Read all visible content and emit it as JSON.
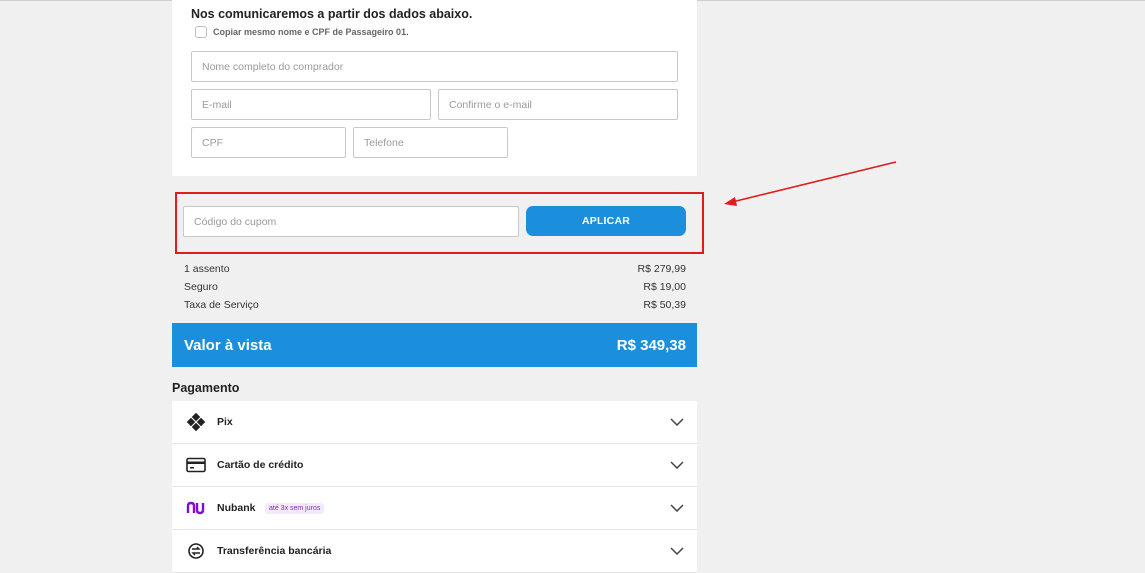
{
  "buyer": {
    "title": "Nos comunicaremos a partir dos dados abaixo.",
    "copy_label": "Copiar mesmo nome e CPF de Passageiro 01.",
    "fields": {
      "full_name_placeholder": "Nome completo do comprador",
      "email_placeholder": "E-mail",
      "email_confirm_placeholder": "Confirme o e-mail",
      "cpf_placeholder": "CPF",
      "phone_placeholder": "Telefone"
    }
  },
  "coupon": {
    "placeholder": "Código do cupom",
    "apply_label": "APLICAR",
    "highlight_color": "#e21b1b"
  },
  "summary": {
    "rows": [
      {
        "label": "1 assento",
        "value": "R$ 279,99"
      },
      {
        "label": "Seguro",
        "value": "R$ 19,00"
      },
      {
        "label": "Taxa de Serviço",
        "value": "R$ 50,39"
      }
    ],
    "total_label": "Valor à vista",
    "total_value": "R$ 349,38"
  },
  "payment": {
    "title": "Pagamento",
    "methods": [
      {
        "icon": "pix-icon",
        "label": "Pix"
      },
      {
        "icon": "credit-card-icon",
        "label": "Cartão de crédito"
      },
      {
        "icon": "nubank-icon",
        "label": "Nubank",
        "badge": "até 3x sem juros"
      },
      {
        "icon": "bank-transfer-icon",
        "label": "Transferência bancária"
      }
    ]
  },
  "colors": {
    "accent": "#1b8fdc",
    "annotation": "#e21b1b",
    "nubank": "#820ad1"
  }
}
